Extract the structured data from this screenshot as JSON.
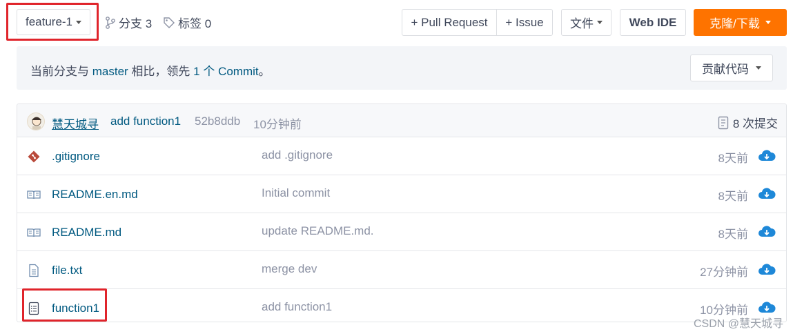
{
  "toolbar": {
    "branch": "feature-1",
    "branches_label": "分支 3",
    "tags_label": "标签 0",
    "pull_request": "+ Pull Request",
    "issue": "+ Issue",
    "files": "文件",
    "web_ide": "Web IDE",
    "clone": "克隆/下载"
  },
  "compare": {
    "prefix": "当前分支与 ",
    "base": "master",
    "middle": " 相比，领先 ",
    "ahead": "1 个 Commit",
    "suffix": "。",
    "contribute": "贡献代码"
  },
  "latest_commit": {
    "author": "慧天城寻",
    "message": "add function1",
    "sha": "52b8ddb",
    "time": "10分钟前",
    "commit_count": "8 次提交"
  },
  "files": [
    {
      "icon": "git-icon",
      "name": ".gitignore",
      "message": "add .gitignore",
      "time": "8天前"
    },
    {
      "icon": "book-icon",
      "name": "README.en.md",
      "message": "Initial commit",
      "time": "8天前"
    },
    {
      "icon": "book-icon",
      "name": "README.md",
      "message": "update README.md.",
      "time": "8天前"
    },
    {
      "icon": "file-icon",
      "name": "file.txt",
      "message": "merge dev",
      "time": "27分钟前"
    },
    {
      "icon": "file-text-icon",
      "name": "function1",
      "message": "add function1",
      "time": "10分钟前"
    }
  ],
  "colors": {
    "accent": "#fe7300",
    "link": "#005980",
    "highlight": "#e0242b",
    "download": "#1e88d8"
  },
  "watermark": "CSDN @慧天城寻"
}
